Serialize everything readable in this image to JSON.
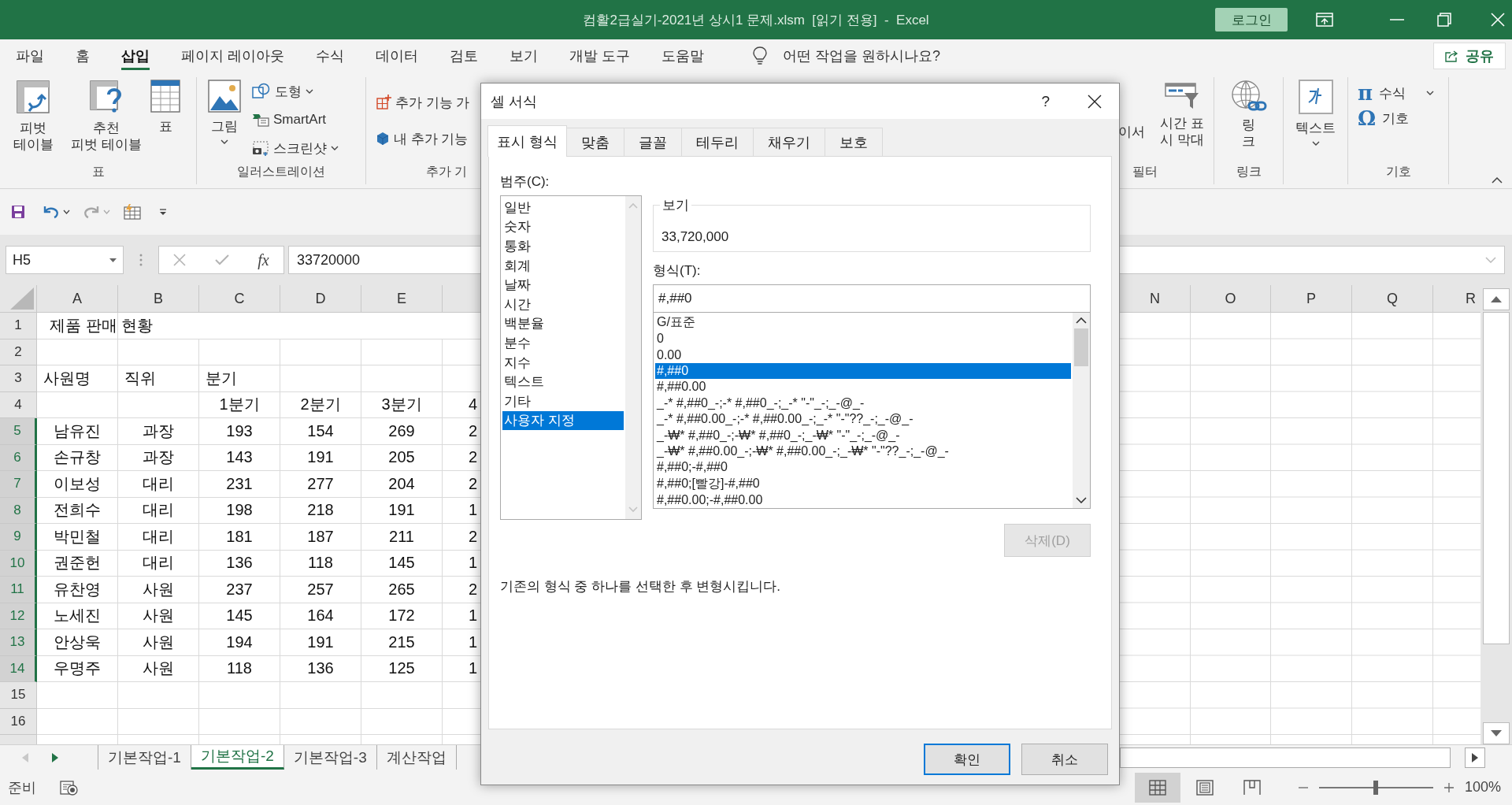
{
  "window": {
    "title": "컴활2급실기-2021년 상시1 문제.xlsm  [읽기 전용]  -  Excel",
    "login": "로그인"
  },
  "menu_tabs": [
    {
      "label": "파일",
      "selected": false
    },
    {
      "label": "홈",
      "selected": false
    },
    {
      "label": "삽입",
      "selected": true
    },
    {
      "label": "페이지 레이아웃",
      "selected": false
    },
    {
      "label": "수식",
      "selected": false
    },
    {
      "label": "데이터",
      "selected": false
    },
    {
      "label": "검토",
      "selected": false
    },
    {
      "label": "보기",
      "selected": false
    },
    {
      "label": "개발 도구",
      "selected": false
    },
    {
      "label": "도움말",
      "selected": false
    }
  ],
  "tell_me": {
    "placeholder": "어떤 작업을 원하시나요?"
  },
  "share_button": "공유",
  "ribbon": {
    "tables_group": {
      "label": "표",
      "pivot_table": "피벗\n테이블",
      "recommended_pivot": "추천\n피벗 테이블",
      "table": "표"
    },
    "illustrations_group": {
      "label": "일러스트레이션",
      "pictures": "그림",
      "shapes": "도형",
      "smartart": "SmartArt",
      "screenshot": "스크린샷"
    },
    "addins_group": {
      "label": "추가 기",
      "get_addins": "추가 기능 가",
      "my_addins": "내 추가 기능"
    },
    "filters_group": {
      "label": "필터",
      "slicer": "이서",
      "timeline": "시간 표\n시 막대"
    },
    "links_group": {
      "label": "링크",
      "link": "링\n크"
    },
    "text_group": {
      "text": "텍스트"
    },
    "symbols_group": {
      "label": "기호",
      "equation_icon": "π",
      "equation": "수식",
      "symbol_icon": "Ω",
      "symbol": "기호"
    }
  },
  "formula_bar": {
    "name_box": "H5",
    "function_icon": "fx",
    "formula": "33720000"
  },
  "sheet": {
    "columns_left": [
      "A",
      "B",
      "C",
      "D",
      "E"
    ],
    "columns_right": [
      "N",
      "O",
      "P",
      "Q",
      "R"
    ],
    "rows": [
      {
        "number": "1",
        "selected": false,
        "kind": "title",
        "cells": {
          "a": "제품 판매 현황"
        }
      },
      {
        "number": "2",
        "selected": false,
        "kind": "blank",
        "cells": {}
      },
      {
        "number": "3",
        "selected": false,
        "kind": "heading",
        "cells": {
          "a": "사원명",
          "b": "직위",
          "c": "분기"
        }
      },
      {
        "number": "4",
        "selected": false,
        "kind": "data",
        "cells": {
          "c": "1분기",
          "d": "2분기",
          "e": "3분기",
          "f": "4"
        }
      },
      {
        "number": "5",
        "selected": true,
        "kind": "data",
        "cells": {
          "a": "남유진",
          "b": "과장",
          "c": "193",
          "d": "154",
          "e": "269",
          "f": "2"
        }
      },
      {
        "number": "6",
        "selected": true,
        "kind": "data",
        "cells": {
          "a": "손규창",
          "b": "과장",
          "c": "143",
          "d": "191",
          "e": "205",
          "f": "2"
        }
      },
      {
        "number": "7",
        "selected": true,
        "kind": "data",
        "cells": {
          "a": "이보성",
          "b": "대리",
          "c": "231",
          "d": "277",
          "e": "204",
          "f": "2"
        }
      },
      {
        "number": "8",
        "selected": true,
        "kind": "data",
        "cells": {
          "a": "전희수",
          "b": "대리",
          "c": "198",
          "d": "218",
          "e": "191",
          "f": "1"
        }
      },
      {
        "number": "9",
        "selected": true,
        "kind": "data",
        "cells": {
          "a": "박민철",
          "b": "대리",
          "c": "181",
          "d": "187",
          "e": "211",
          "f": "2"
        }
      },
      {
        "number": "10",
        "selected": true,
        "kind": "data",
        "cells": {
          "a": "권준헌",
          "b": "대리",
          "c": "136",
          "d": "118",
          "e": "145",
          "f": "1"
        }
      },
      {
        "number": "11",
        "selected": true,
        "kind": "data",
        "cells": {
          "a": "유찬영",
          "b": "사원",
          "c": "237",
          "d": "257",
          "e": "265",
          "f": "2"
        }
      },
      {
        "number": "12",
        "selected": true,
        "kind": "data",
        "cells": {
          "a": "노세진",
          "b": "사원",
          "c": "145",
          "d": "164",
          "e": "172",
          "f": "1"
        }
      },
      {
        "number": "13",
        "selected": true,
        "kind": "data",
        "cells": {
          "a": "안상욱",
          "b": "사원",
          "c": "194",
          "d": "191",
          "e": "215",
          "f": "1"
        }
      },
      {
        "number": "14",
        "selected": true,
        "kind": "data",
        "cells": {
          "a": "우명주",
          "b": "사원",
          "c": "118",
          "d": "136",
          "e": "125",
          "f": "1"
        }
      },
      {
        "number": "15",
        "selected": false,
        "kind": "blank",
        "cells": {}
      },
      {
        "number": "16",
        "selected": false,
        "kind": "blank",
        "cells": {}
      }
    ]
  },
  "sheet_tabs": [
    {
      "label": "기본작업-1",
      "selected": false
    },
    {
      "label": "기본작업-2",
      "selected": true
    },
    {
      "label": "기본작업-3",
      "selected": false
    },
    {
      "label": "계산작업",
      "selected": false
    }
  ],
  "status_bar": {
    "ready": "준비",
    "views": [
      {
        "selected": true
      },
      {
        "selected": false
      },
      {
        "selected": false
      }
    ],
    "zoom_slider": {
      "level": 0.5
    },
    "zoom": "100%"
  },
  "dialog": {
    "title": "셀 서식",
    "help": "?",
    "tabs": [
      {
        "label": "표시 형식",
        "selected": true
      },
      {
        "label": "맞춤",
        "selected": false
      },
      {
        "label": "글꼴",
        "selected": false
      },
      {
        "label": "테두리",
        "selected": false
      },
      {
        "label": "채우기",
        "selected": false
      },
      {
        "label": "보호",
        "selected": false
      }
    ],
    "category_label": "범주(C):",
    "categories": [
      {
        "label": "일반",
        "selected": false
      },
      {
        "label": "숫자",
        "selected": false
      },
      {
        "label": "통화",
        "selected": false
      },
      {
        "label": "회계",
        "selected": false
      },
      {
        "label": "날짜",
        "selected": false
      },
      {
        "label": "시간",
        "selected": false
      },
      {
        "label": "백분율",
        "selected": false
      },
      {
        "label": "분수",
        "selected": false
      },
      {
        "label": "지수",
        "selected": false
      },
      {
        "label": "텍스트",
        "selected": false
      },
      {
        "label": "기타",
        "selected": false
      },
      {
        "label": "사용자 지정",
        "selected": true
      }
    ],
    "sample_label": "보기",
    "sample_value": "33,720,000",
    "type_label": "형식(T):",
    "type_value": "#,##0",
    "formats": [
      {
        "label": "G/표준",
        "selected": false
      },
      {
        "label": "0",
        "selected": false
      },
      {
        "label": "0.00",
        "selected": false
      },
      {
        "label": "#,##0",
        "selected": true
      },
      {
        "label": "#,##0.00",
        "selected": false
      },
      {
        "label": "_-* #,##0_-;-* #,##0_-;_-* \"-\"_-;_-@_-",
        "selected": false
      },
      {
        "label": "_-* #,##0.00_-;-* #,##0.00_-;_-* \"-\"??_-;_-@_-",
        "selected": false
      },
      {
        "label": "_-₩* #,##0_-;-₩* #,##0_-;_-₩* \"-\"_-;_-@_-",
        "selected": false
      },
      {
        "label": "_-₩* #,##0.00_-;-₩* #,##0.00_-;_-₩* \"-\"??_-;_-@_-",
        "selected": false
      },
      {
        "label": "#,##0;-#,##0",
        "selected": false
      },
      {
        "label": "#,##0;[빨강]-#,##0",
        "selected": false
      },
      {
        "label": "#,##0.00;-#,##0.00",
        "selected": false
      }
    ],
    "delete_button": {
      "label": "삭제(D)",
      "disabled": true
    },
    "description": "기존의 형식 중 하나를 선택한 후 변형시킵니다.",
    "ok_button": "확인",
    "cancel_button": "취소"
  }
}
